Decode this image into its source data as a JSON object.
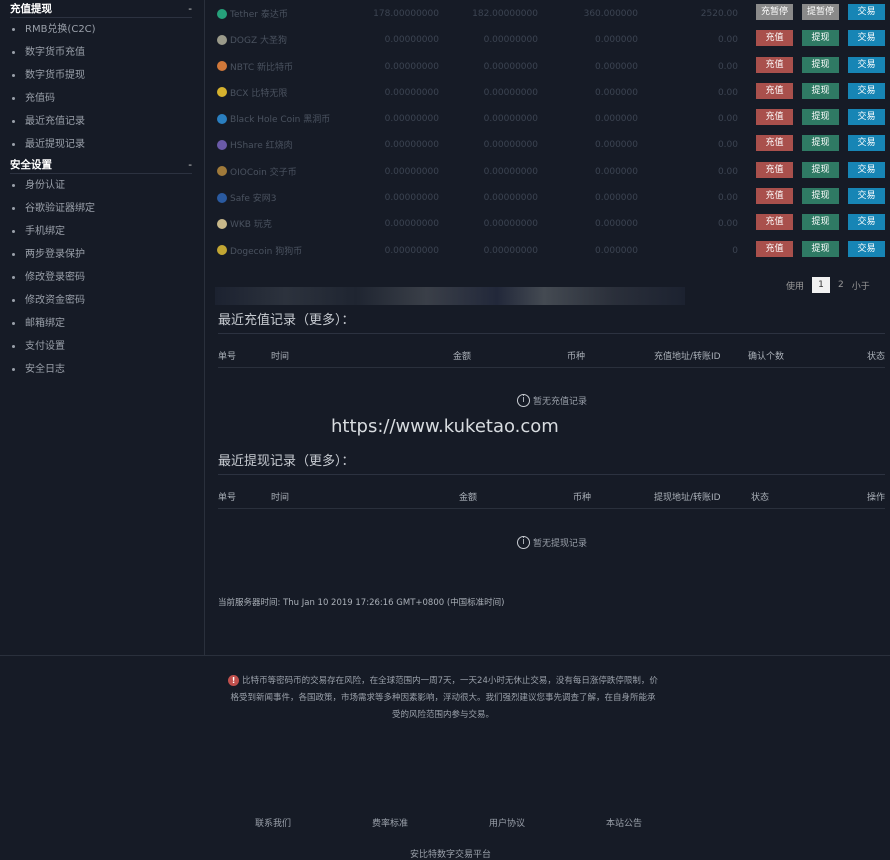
{
  "sidebar": {
    "sections": [
      {
        "title": "充值提现",
        "toggle": "-",
        "items": [
          "RMB兑换(C2C)",
          "数字货币充值",
          "数字货币提现",
          "充值码",
          "最近充值记录",
          "最近提现记录"
        ]
      },
      {
        "title": "安全设置",
        "toggle": "-",
        "items": [
          "身份认证",
          "谷歌验证器绑定",
          "手机绑定",
          "两步登录保护",
          "修改登录密码",
          "修改资金密码",
          "邮箱绑定",
          "支付设置",
          "安全日志"
        ]
      }
    ]
  },
  "assets": [
    {
      "name": "Tether 泰达币",
      "icon_color": "#26a17b",
      "v1": "178.00000000",
      "v2": "182.00000000",
      "v3": "360.000000",
      "v4": "2520.00",
      "b1": "充暂停",
      "b2": "提暂停",
      "b3": "交易",
      "paused": true
    },
    {
      "name": "DOGZ 大圣狗",
      "icon_color": "#9a9a8a",
      "v1": "0.00000000",
      "v2": "0.00000000",
      "v3": "0.000000",
      "v4": "0.00",
      "b1": "充值",
      "b2": "提现",
      "b3": "交易"
    },
    {
      "name": "NBTC 新比特币",
      "icon_color": "#d0783a",
      "v1": "0.00000000",
      "v2": "0.00000000",
      "v3": "0.000000",
      "v4": "0.00",
      "b1": "充值",
      "b2": "提现",
      "b3": "交易"
    },
    {
      "name": "BCX 比特无限",
      "icon_color": "#d6b22e",
      "v1": "0.00000000",
      "v2": "0.00000000",
      "v3": "0.000000",
      "v4": "0.00",
      "b1": "充值",
      "b2": "提现",
      "b3": "交易"
    },
    {
      "name": "Black Hole Coin 黑洞币",
      "icon_color": "#2a7fc0",
      "v1": "0.00000000",
      "v2": "0.00000000",
      "v3": "0.000000",
      "v4": "0.00",
      "b1": "充值",
      "b2": "提现",
      "b3": "交易"
    },
    {
      "name": "HShare 红烧肉",
      "icon_color": "#6a5aa8",
      "v1": "0.00000000",
      "v2": "0.00000000",
      "v3": "0.000000",
      "v4": "0.00",
      "b1": "充值",
      "b2": "提现",
      "b3": "交易"
    },
    {
      "name": "OIOCoin 交子币",
      "icon_color": "#a07a3a",
      "v1": "0.00000000",
      "v2": "0.00000000",
      "v3": "0.000000",
      "v4": "0.00",
      "b1": "充值",
      "b2": "提现",
      "b3": "交易"
    },
    {
      "name": "Safe 安网3",
      "icon_color": "#2a5aa0",
      "v1": "0.00000000",
      "v2": "0.00000000",
      "v3": "0.000000",
      "v4": "0.00",
      "b1": "充值",
      "b2": "提现",
      "b3": "交易"
    },
    {
      "name": "WKB 玩克",
      "icon_color": "#c8b88a",
      "v1": "0.00000000",
      "v2": "0.00000000",
      "v3": "0.000000",
      "v4": "0.00",
      "b1": "充值",
      "b2": "提现",
      "b3": "交易"
    },
    {
      "name": "Dogecoin 狗狗币",
      "icon_color": "#c2a633",
      "v1": "0.00000000",
      "v2": "0.00000000",
      "v3": "0.000000",
      "v4": "0",
      "b1": "充值",
      "b2": "提现",
      "b3": "交易"
    }
  ],
  "pager": {
    "prev": "使用",
    "pages": [
      "1",
      "2"
    ],
    "next": "小于"
  },
  "deposit": {
    "title": "最近充值记录（更多）：",
    "headers": [
      "单号",
      "时间",
      "金额",
      "币种",
      "充值地址/转账ID",
      "确认个数",
      "状态"
    ],
    "empty": "暂无充值记录"
  },
  "withdraw": {
    "title": "最近提现记录（更多）：",
    "headers": [
      "单号",
      "时间",
      "金额",
      "币种",
      "提现地址/转账ID",
      "状态",
      "操作"
    ],
    "empty": "暂无提现记录"
  },
  "watermark": "https://www.kuketao.com",
  "server_time": "当前服务器时间: Thu Jan 10 2019 17:26:16 GMT+0800 (中国标准时间)",
  "footer": {
    "risk": "比特币等密码币的交易存在风险，在全球范围内一周7天，一天24小时无休止交易，没有每日涨停跌停限制，价格受到新闻事件，各国政策，市场需求等多种因素影响，浮动很大。我们强烈建议您事先调查了解，在自身所能承受的风险范围内参与交易。",
    "links": [
      "联系我们",
      "费率标准",
      "用户协议",
      "本站公告"
    ],
    "platform": "安比特数字交易平台"
  }
}
